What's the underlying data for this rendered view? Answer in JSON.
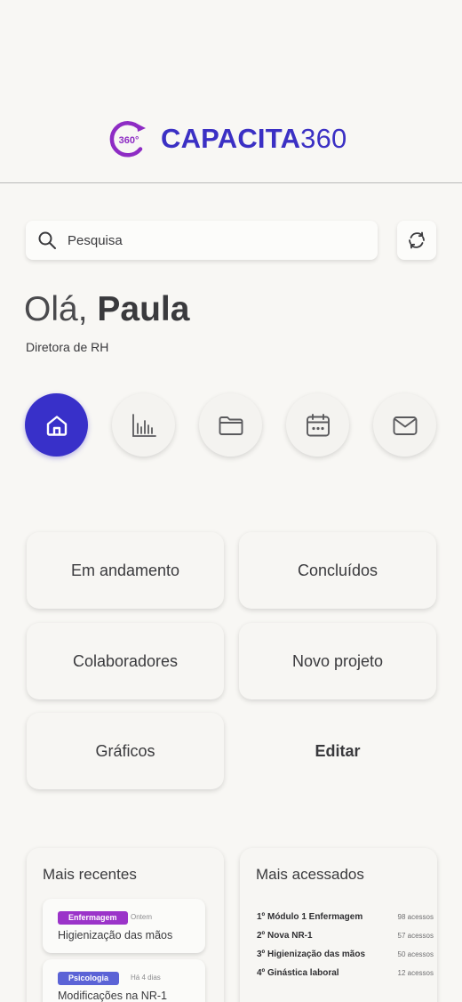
{
  "brand": {
    "name_bold": "CAPACITA",
    "name_light": "360",
    "mark_text": "360°",
    "color": "#3b30c4",
    "mark_color": "#8e2cc4"
  },
  "search": {
    "placeholder": "Pesquisa",
    "value": ""
  },
  "user": {
    "greeting": "Olá,",
    "name": "Paula",
    "role": "Diretora de RH"
  },
  "nav": [
    {
      "icon": "home-icon",
      "active": true
    },
    {
      "icon": "bar-chart-icon",
      "active": false
    },
    {
      "icon": "folder-icon",
      "active": false
    },
    {
      "icon": "calendar-icon",
      "active": false
    },
    {
      "icon": "mail-icon",
      "active": false
    }
  ],
  "tiles": {
    "in_progress": "Em andamento",
    "completed": "Concluídos",
    "collaborators": "Colaboradores",
    "new_project": "Novo projeto",
    "charts": "Gráficos",
    "edit": "Editar"
  },
  "recent": {
    "title": "Mais recentes",
    "items": [
      {
        "tag": "Enfermagem",
        "tag_color": "#9b34c9",
        "when": "Ontem",
        "title": "Higienização das mãos"
      },
      {
        "tag": "Psicologia",
        "tag_color": "#5b63d6",
        "when": "Há 4 dias",
        "title": "Modificações na NR-1"
      }
    ]
  },
  "most_accessed": {
    "title": "Mais acessados",
    "items": [
      {
        "name": "1º Módulo 1 Enfermagem",
        "count": "98 acessos"
      },
      {
        "name": "2º Nova NR-1",
        "count": "57 acessos"
      },
      {
        "name": "3º Higienização das mãos",
        "count": "50 acessos"
      },
      {
        "name": "4º Ginástica laboral",
        "count": "12 acessos"
      }
    ]
  }
}
